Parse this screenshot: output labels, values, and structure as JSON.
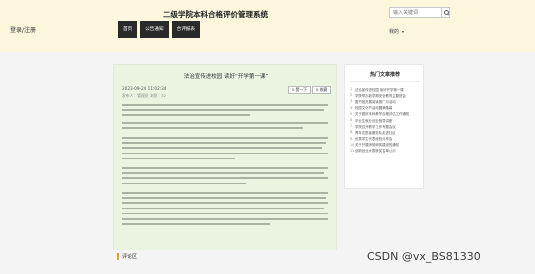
{
  "header": {
    "site_title": "二级学院本科合格评价管理系统",
    "search_placeholder": "输入关键词",
    "login_label": "登录/注册",
    "me_label": "我的",
    "nav": [
      "首页",
      "公告通知",
      "合评报表"
    ]
  },
  "article": {
    "title": "法治宣传进校园 读好“开学第一课”",
    "date": "2023-09-24 11:02:34",
    "meta": "发布人：管理员  浏览：32",
    "like_label": "0 赞一下",
    "fav_label": "0 收藏"
  },
  "comments": {
    "title": "评论区"
  },
  "sidebar": {
    "title": "热门文章推荐",
    "items": [
      "法治宣传进校园 读好开学第一课",
      "学院举办新学期安全教育主题班会",
      "图书馆开展阅读推广月活动",
      "校园文化节活动圆满落幕",
      "关于做好本科教学合格评估工作通知",
      "毕业生就业创业指导讲座",
      "学院召开教学工作专题会议",
      "青年志愿者服务队走进社区",
      "优秀学生代表经验分享会",
      "关于开展师德师风建设的通知",
      "创新创业大赛获奖名单公示"
    ]
  },
  "watermark": "CSDN @vx_BS81330"
}
